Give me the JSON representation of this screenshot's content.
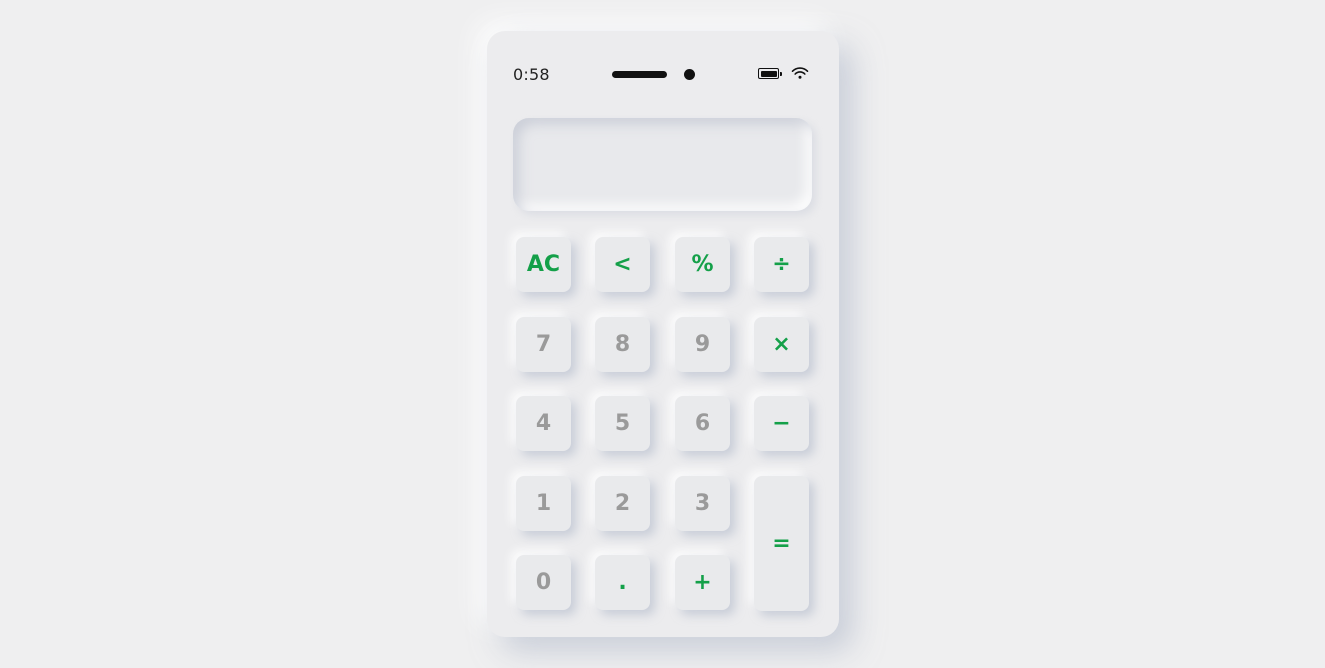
{
  "status_bar": {
    "time": "0:58"
  },
  "display": {
    "value": ""
  },
  "theme": {
    "accent_color": "#14a049",
    "number_color": "#9a9a9a",
    "surface_color": "#ececee"
  },
  "keys": {
    "clear": "AC",
    "backspace": "<",
    "percent": "%",
    "divide": "÷",
    "seven": "7",
    "eight": "8",
    "nine": "9",
    "multiply": "×",
    "four": "4",
    "five": "5",
    "six": "6",
    "subtract": "−",
    "one": "1",
    "two": "2",
    "three": "3",
    "equals": "=",
    "zero": "0",
    "decimal": ".",
    "add": "+"
  }
}
